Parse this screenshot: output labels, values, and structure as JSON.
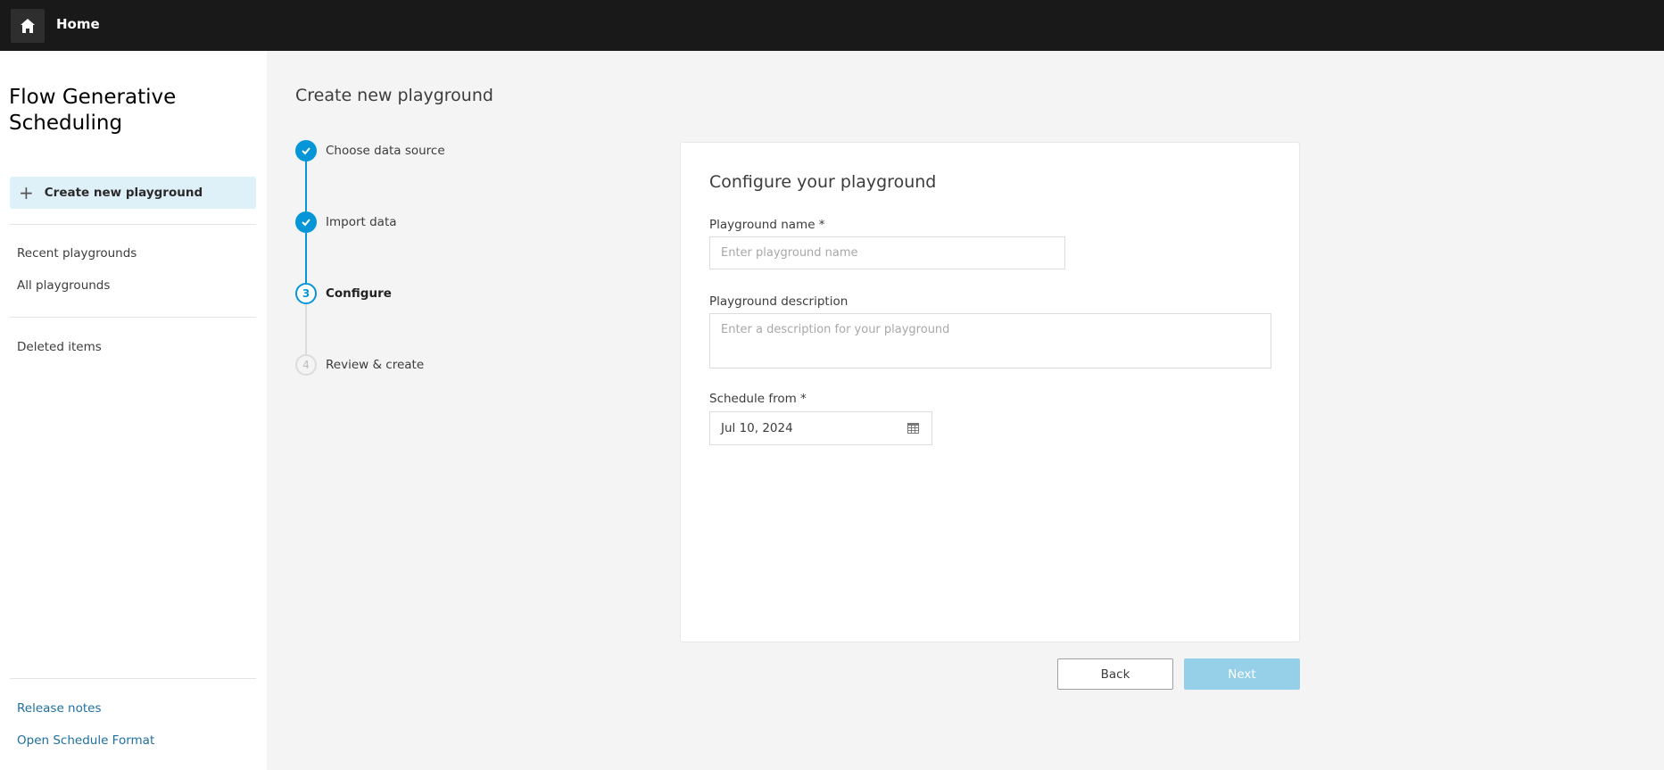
{
  "topbar": {
    "home_label": "Home",
    "home_icon": "home-icon"
  },
  "sidebar": {
    "app_title": "Flow Generative Scheduling",
    "create_button": "Create new playground",
    "nav": [
      {
        "label": "Recent playgrounds"
      },
      {
        "label": "All playgrounds"
      },
      {
        "label": "Deleted items"
      }
    ],
    "footer_links": [
      {
        "label": "Release notes"
      },
      {
        "label": "Open Schedule Format"
      }
    ]
  },
  "main": {
    "title": "Create new playground",
    "steps": [
      {
        "number": "1",
        "label": "Choose data source",
        "status": "done"
      },
      {
        "number": "2",
        "label": "Import data",
        "status": "done"
      },
      {
        "number": "3",
        "label": "Configure",
        "status": "active"
      },
      {
        "number": "4",
        "label": "Review & create",
        "status": "todo"
      }
    ],
    "card": {
      "title": "Configure your playground",
      "name_label": "Playground name *",
      "name_placeholder": "Enter playground name",
      "name_value": "",
      "description_label": "Playground description",
      "description_placeholder": "Enter a description for your playground",
      "description_value": "",
      "schedule_label": "Schedule from *",
      "schedule_value": "Jul 10, 2024"
    },
    "back_label": "Back",
    "next_label": "Next"
  },
  "colors": {
    "accent": "#0696d7",
    "next_disabled": "#96cfe8",
    "sidebar_active": "#def1f8",
    "topbar": "#191919",
    "link": "#1e6fa0"
  }
}
